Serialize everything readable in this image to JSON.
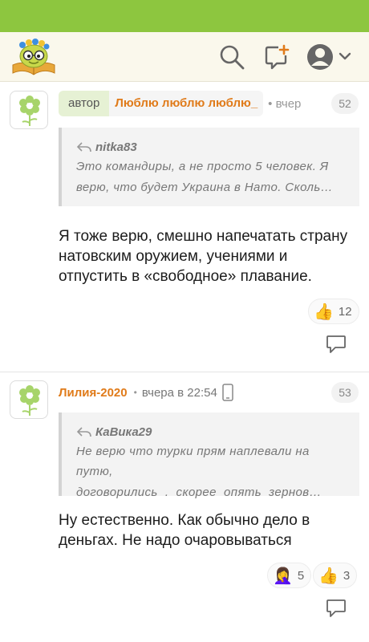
{
  "comments": [
    {
      "author_tag": "автор",
      "author": "Люблю люблю люблю_",
      "time": "• вчер",
      "number": "52",
      "quote": {
        "user": "nitka83",
        "lines": [
          "Это командиры, а не просто 5 человек. Я",
          "верю, что будет Украина в Нато. Сколь…"
        ]
      },
      "text": "Я тоже верю, смешно напечатать страну натовским оружием, учениями и отпустить в «свободное» плавание.",
      "reactions": [
        {
          "icon": "thumbs-up-icon",
          "emoji": "👍",
          "count": "12"
        }
      ]
    },
    {
      "author": "Лилия-2020",
      "time": "вчера в 22:54",
      "number": "53",
      "quote": {
        "user": "КаВика29",
        "lines": [
          "Не верю что турки прям наплевали на путю,",
          "договорились  .  скорее  опять  зернов…"
        ]
      },
      "text": "Ну естественно. Как обычно дело в деньгах. Не надо очаровываться",
      "reactions": [
        {
          "icon": "facepalm-icon",
          "emoji": "🤦‍♀️",
          "count": "5"
        },
        {
          "icon": "thumbs-up-icon",
          "emoji": "👍",
          "count": "3"
        }
      ]
    }
  ],
  "colors": {
    "brand_green": "#8dc63f",
    "author_orange": "#e07b1a",
    "header_bg": "#faf8ec"
  }
}
